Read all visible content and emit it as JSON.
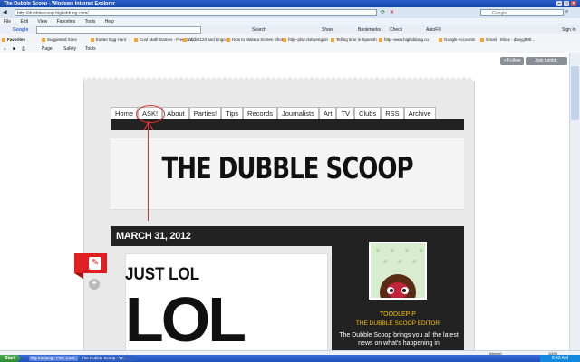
{
  "window": {
    "title": "The Dubble Scoop - Windows Internet Explorer"
  },
  "address": {
    "url": "http://dubblescoop.bigkiddung.com/"
  },
  "search_box": {
    "placeholder": "Google"
  },
  "menu": [
    "File",
    "Edit",
    "View",
    "Favorites",
    "Tools",
    "Help"
  ],
  "google_toolbar": {
    "logo": "Google",
    "search": "Search",
    "share": "Share",
    "bookmarks": "Bookmarks",
    "check": "Check",
    "autofill": "AutoFill",
    "signin": "Sign In"
  },
  "favorites": {
    "label": "Favorites",
    "items": [
      "Suggested Sites",
      "Easter Egg Hunt",
      "Cool Math Games - Free Onl...",
      "Addict123 and kingcole",
      "How to Make a Screen Shot ...",
      "http--play.clubpenguin",
      "Telling time in Spanish",
      "http--www.bigkiddung.co",
      "Google Accounts",
      "Gmail - Inbox - davyg890..."
    ]
  },
  "commands": {
    "page": "Page",
    "safety": "Safety",
    "tools": "Tools"
  },
  "tumblr": {
    "follow": "+ Follow",
    "join": "Join tumblr."
  },
  "nav": [
    "Home",
    "ASK!",
    "About",
    "Parties!",
    "Tips",
    "Records",
    "Journalists",
    "Art",
    "TV",
    "Clubs",
    "RSS",
    "Archive"
  ],
  "site": {
    "title": "THE DUBBLE SCOOP"
  },
  "post": {
    "date": "MARCH 31, 2012",
    "title": "JUST LOL",
    "big_text": "LOL"
  },
  "sidebar": {
    "name": "TOODLEPIP",
    "role": "THE DUBBLE SCOOP EDITOR",
    "description": "The Dubble Scoop brings you all the latest news on what's happening in"
  },
  "status": {
    "zone": "Internet",
    "zoom": "100%"
  },
  "taskbar": {
    "start": "Start",
    "items": [
      "Big Kiddung - Fun, Cool...",
      "The Dubble Scoop - W..."
    ],
    "clock": "8:43 AM"
  },
  "colors": {
    "accent_red": "#e02020",
    "annotation": "#e03030",
    "title_gold": "#f6c000"
  }
}
